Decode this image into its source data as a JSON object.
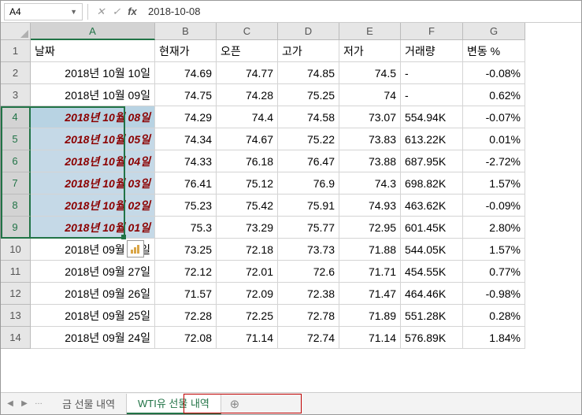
{
  "formula_bar": {
    "name_box": "A4",
    "value": "2018-10-08"
  },
  "col_headers": [
    "A",
    "B",
    "C",
    "D",
    "E",
    "F",
    "G"
  ],
  "row_headers": [
    "1",
    "2",
    "3",
    "4",
    "5",
    "6",
    "7",
    "8",
    "9",
    "10",
    "11",
    "12",
    "13",
    "14"
  ],
  "header_row": {
    "A": "날짜",
    "B": "현재가",
    "C": "오픈",
    "D": "고가",
    "E": "저가",
    "F": "거래량",
    "G": "변동 %"
  },
  "rows": [
    {
      "A": "2018년 10월 10일",
      "B": "74.69",
      "C": "74.77",
      "D": "74.85",
      "E": "74.5",
      "F": "-",
      "G": "-0.08%",
      "sel": false
    },
    {
      "A": "2018년 10월 09일",
      "B": "74.75",
      "C": "74.28",
      "D": "75.25",
      "E": "74",
      "F": "-",
      "G": "0.62%",
      "sel": false
    },
    {
      "A": "2018년 10월 08일",
      "B": "74.29",
      "C": "74.4",
      "D": "74.58",
      "E": "73.07",
      "F": "554.94K",
      "G": "-0.07%",
      "sel": true,
      "anchor": true
    },
    {
      "A": "2018년 10월 05일",
      "B": "74.34",
      "C": "74.67",
      "D": "75.22",
      "E": "73.83",
      "F": "613.22K",
      "G": "0.01%",
      "sel": true
    },
    {
      "A": "2018년 10월 04일",
      "B": "74.33",
      "C": "76.18",
      "D": "76.47",
      "E": "73.88",
      "F": "687.95K",
      "G": "-2.72%",
      "sel": true
    },
    {
      "A": "2018년 10월 03일",
      "B": "76.41",
      "C": "75.12",
      "D": "76.9",
      "E": "74.3",
      "F": "698.82K",
      "G": "1.57%",
      "sel": true
    },
    {
      "A": "2018년 10월 02일",
      "B": "75.23",
      "C": "75.42",
      "D": "75.91",
      "E": "74.93",
      "F": "463.62K",
      "G": "-0.09%",
      "sel": true
    },
    {
      "A": "2018년 10월 01일",
      "B": "75.3",
      "C": "73.29",
      "D": "75.77",
      "E": "72.95",
      "F": "601.45K",
      "G": "2.80%",
      "sel": true
    },
    {
      "A": "2018년 09월 28일",
      "B": "73.25",
      "C": "72.18",
      "D": "73.73",
      "E": "71.88",
      "F": "544.05K",
      "G": "1.57%",
      "sel": false
    },
    {
      "A": "2018년 09월 27일",
      "B": "72.12",
      "C": "72.01",
      "D": "72.6",
      "E": "71.71",
      "F": "454.55K",
      "G": "0.77%",
      "sel": false
    },
    {
      "A": "2018년 09월 26일",
      "B": "71.57",
      "C": "72.09",
      "D": "72.38",
      "E": "71.47",
      "F": "464.46K",
      "G": "-0.98%",
      "sel": false
    },
    {
      "A": "2018년 09월 25일",
      "B": "72.28",
      "C": "72.25",
      "D": "72.78",
      "E": "71.89",
      "F": "551.28K",
      "G": "0.28%",
      "sel": false
    },
    {
      "A": "2018년 09월 24일",
      "B": "72.08",
      "C": "71.14",
      "D": "72.74",
      "E": "71.14",
      "F": "576.89K",
      "G": "1.84%",
      "sel": false
    }
  ],
  "tabs": {
    "inactive": "금 선물 내역",
    "active": "WTI유 선물 내역"
  }
}
